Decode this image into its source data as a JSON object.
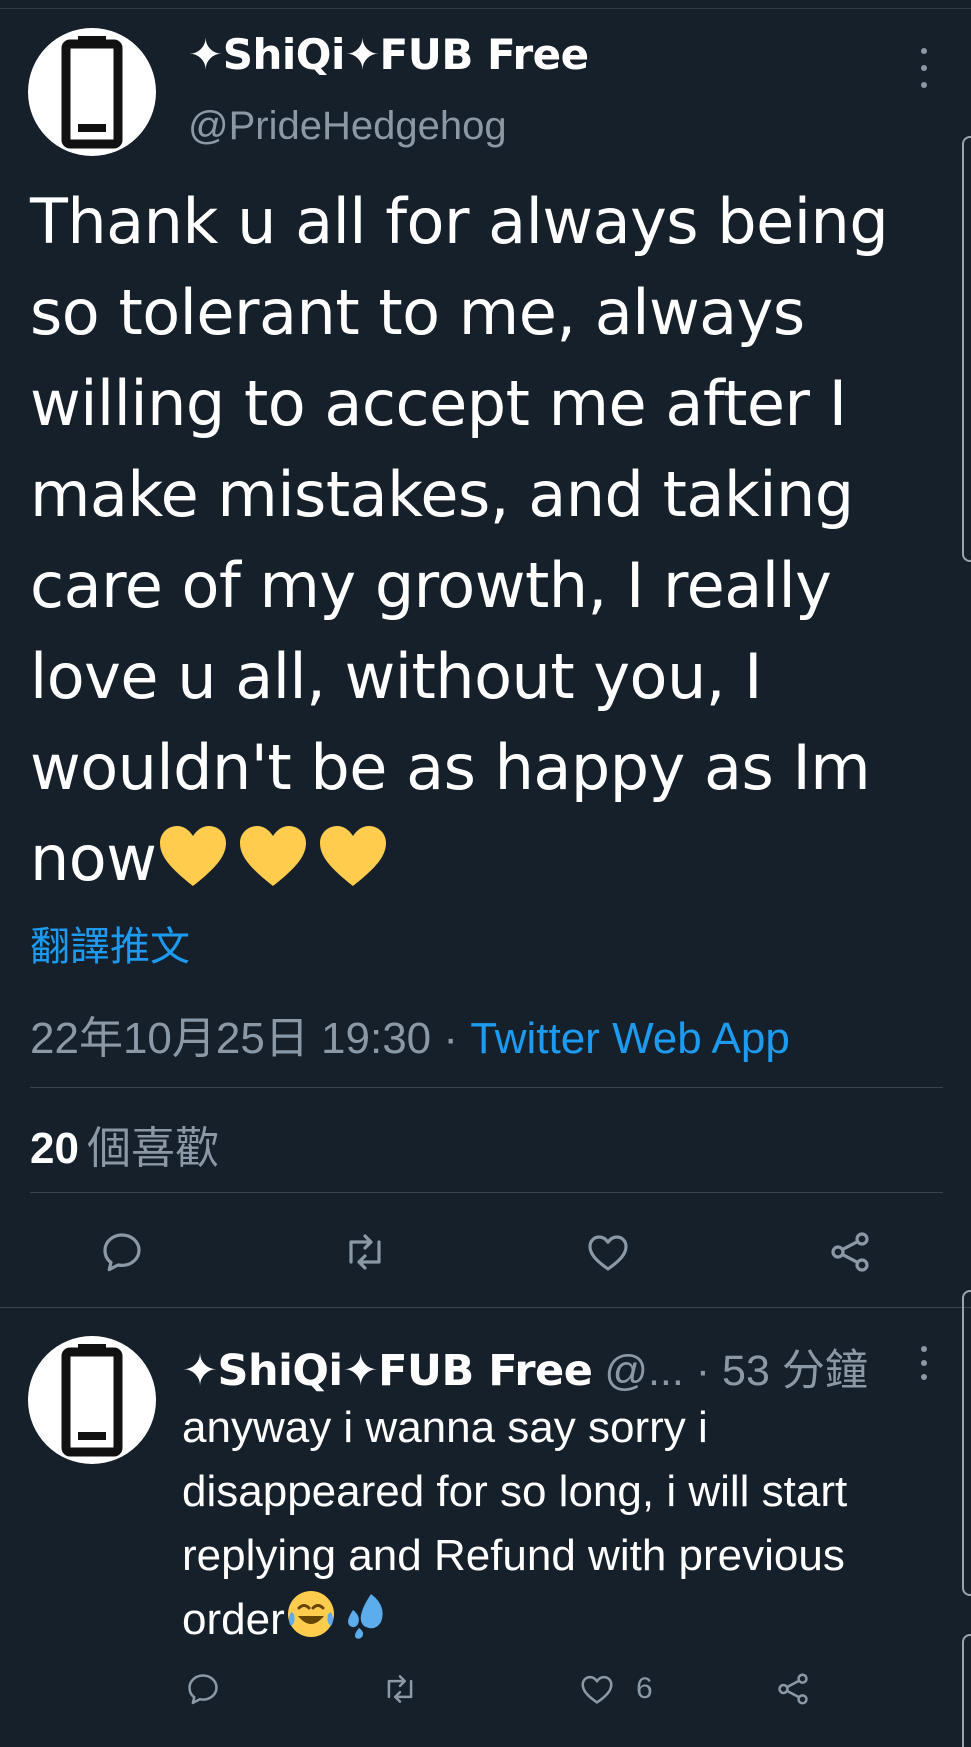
{
  "main_tweet": {
    "display_name": "✦ShiQi✦FUB Free",
    "handle": "@PrideHedgehog",
    "text": "Thank u all for always being\nso tolerant to me, always\nwilling to accept me after I\nmake mistakes, and taking\ncare of my growth, I really\nlove u all, without you, I\nwouldn't be as happy as Im\nnow",
    "emoji": "💛💛💛",
    "translate_label": "翻譯推文",
    "timestamp": "22年10月25日 19:30",
    "separator": " · ",
    "source_app": "Twitter Web App",
    "likes_count": "20",
    "likes_label": "個喜歡"
  },
  "reply_tweet": {
    "display_name": "✦ShiQi✦FUB Free",
    "handle_truncated": " @...",
    "time_ago": "  · 53 分鐘",
    "text": "anyway i wanna say sorry i\ndisappeared for so long, i will start\nreplying and Refund with previous\norder",
    "emoji": "😂💦",
    "like_count": "6"
  },
  "colors": {
    "background": "#15202b",
    "muted_text": "#8b98a5",
    "link": "#1d9bf0",
    "divider": "#38444d"
  },
  "icons": [
    "battery-avatar-icon",
    "more-options-icon",
    "reply-icon",
    "retweet-icon",
    "like-icon",
    "share-icon"
  ]
}
